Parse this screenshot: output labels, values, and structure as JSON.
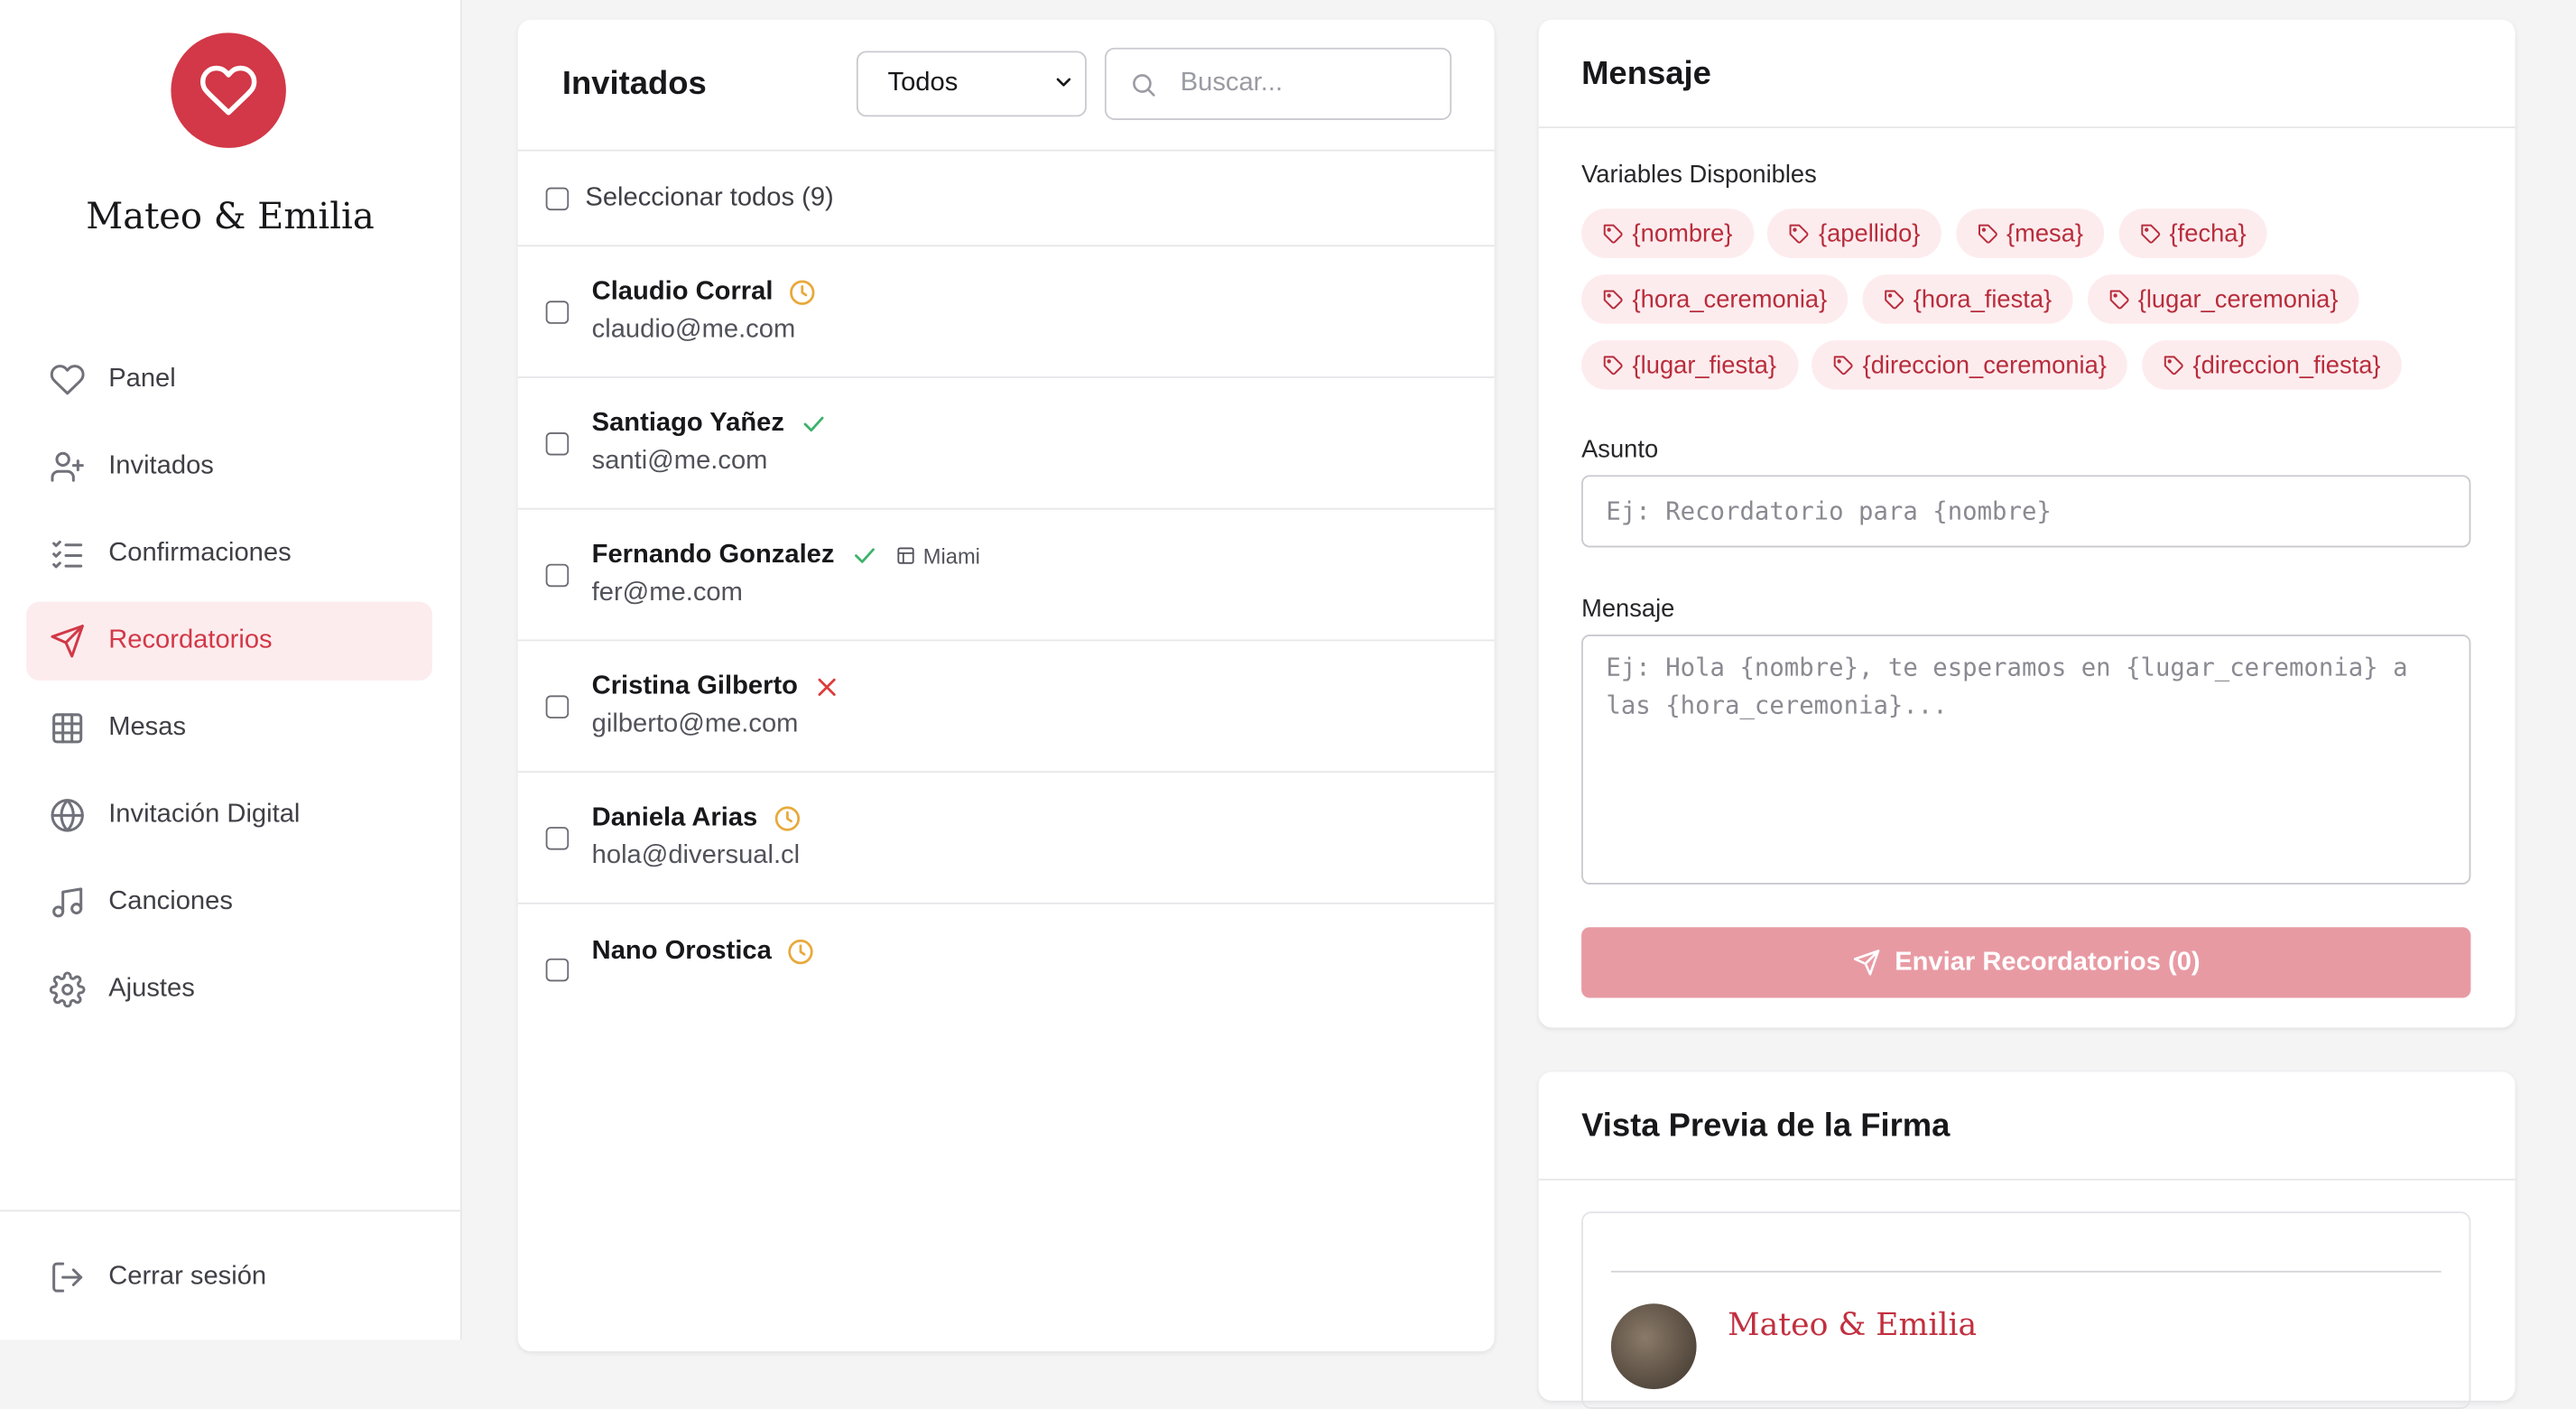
{
  "sidebar": {
    "couple_name": "Mateo & Emilia",
    "items": [
      {
        "label": "Panel",
        "icon": "heart-icon"
      },
      {
        "label": "Invitados",
        "icon": "user-plus-icon"
      },
      {
        "label": "Confirmaciones",
        "icon": "list-check-icon"
      },
      {
        "label": "Recordatorios",
        "icon": "send-icon",
        "active": true
      },
      {
        "label": "Mesas",
        "icon": "grid-icon"
      },
      {
        "label": "Invitación Digital",
        "icon": "globe-icon"
      },
      {
        "label": "Canciones",
        "icon": "music-icon"
      },
      {
        "label": "Ajustes",
        "icon": "gear-icon"
      }
    ],
    "logout_label": "Cerrar sesión"
  },
  "guests": {
    "title": "Invitados",
    "filter_value": "Todos",
    "search_placeholder": "Buscar...",
    "select_all_label": "Seleccionar todos (9)",
    "rows": [
      {
        "name": "Claudio Corral",
        "email": "claudio@me.com",
        "status": "pending"
      },
      {
        "name": "Santiago Yañez",
        "email": "santi@me.com",
        "status": "confirmed"
      },
      {
        "name": "Fernando Gonzalez",
        "email": "fer@me.com",
        "status": "confirmed",
        "table": "Miami"
      },
      {
        "name": "Cristina Gilberto",
        "email": "gilberto@me.com",
        "status": "declined"
      },
      {
        "name": "Daniela Arias",
        "email": "hola@diversual.cl",
        "status": "pending"
      },
      {
        "name": "Nano Orostica",
        "email": "",
        "status": "pending"
      }
    ]
  },
  "message": {
    "title": "Mensaje",
    "variables_label": "Variables Disponibles",
    "variables": [
      "{nombre}",
      "{apellido}",
      "{mesa}",
      "{fecha}",
      "{hora_ceremonia}",
      "{hora_fiesta}",
      "{lugar_ceremonia}",
      "{lugar_fiesta}",
      "{direccion_ceremonia}",
      "{direccion_fiesta}"
    ],
    "subject_label": "Asunto",
    "subject_placeholder": "Ej: Recordatorio para {nombre}",
    "body_label": "Mensaje",
    "body_placeholder_line1": "Ej: Hola {nombre}, te esperamos en {lugar_ceremonia} a",
    "body_placeholder_line2": "las {hora_ceremonia}...",
    "send_label": "Enviar Recordatorios (0)"
  },
  "preview": {
    "title": "Vista Previa de la Firma",
    "signature_name": "Mateo & Emilia"
  },
  "colors": {
    "brand": "#d23847",
    "pending": "#e8a93a",
    "confirmed": "#3bb26a",
    "declined": "#dc3b3b"
  }
}
